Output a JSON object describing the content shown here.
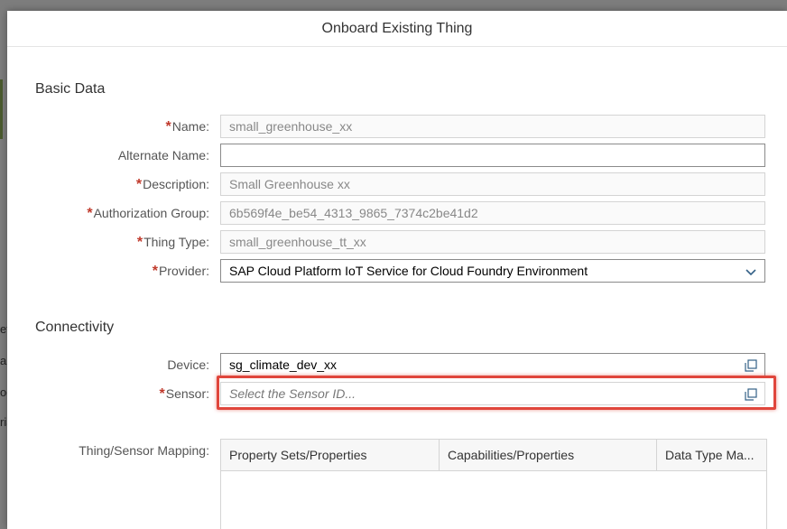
{
  "background": {
    "fragments": [
      "et",
      "al",
      "od",
      "ria"
    ]
  },
  "dialog": {
    "title": "Onboard Existing Thing"
  },
  "basic_data": {
    "section_title": "Basic Data",
    "fields": {
      "name": {
        "label": "Name:",
        "required": true,
        "value": "small_greenhouse_xx"
      },
      "alternate_name": {
        "label": "Alternate Name:",
        "required": false,
        "value": ""
      },
      "description": {
        "label": "Description:",
        "required": true,
        "value": "Small Greenhouse xx"
      },
      "authorization_group": {
        "label": "Authorization Group:",
        "required": true,
        "value": "6b569f4e_be54_4313_9865_7374c2be41d2"
      },
      "thing_type": {
        "label": "Thing Type:",
        "required": true,
        "value": "small_greenhouse_tt_xx"
      },
      "provider": {
        "label": "Provider:",
        "required": true,
        "value": "SAP Cloud Platform IoT Service for Cloud Foundry Environment"
      }
    }
  },
  "connectivity": {
    "section_title": "Connectivity",
    "device": {
      "label": "Device:",
      "value": "sg_climate_dev_xx"
    },
    "sensor": {
      "label": "Sensor:",
      "required": true,
      "placeholder": "Select the Sensor ID..."
    },
    "mapping": {
      "label": "Thing/Sensor Mapping:",
      "columns": [
        "Property Sets/Properties",
        "Capabilities/Properties",
        "Data Type Ma..."
      ]
    }
  },
  "required_marker": "*",
  "colors": {
    "required": "#c0392b",
    "highlight": "#e0463c",
    "border": "#d4d4d4"
  },
  "icons": {
    "value_help": "value-help-icon",
    "dropdown": "chevron-down-icon"
  }
}
